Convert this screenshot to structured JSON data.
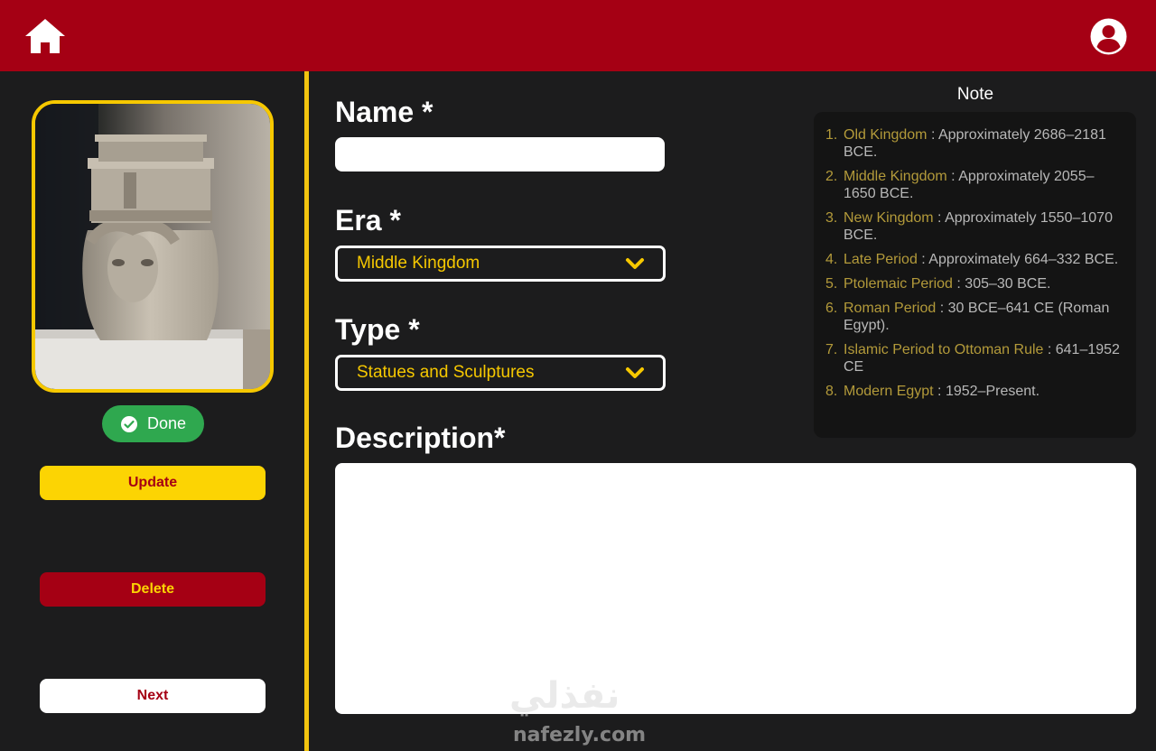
{
  "header": {
    "home_icon": "home-icon",
    "user_icon": "user-account-icon",
    "background_color": "#a50014"
  },
  "sidebar": {
    "status_badge": {
      "label": "Done",
      "icon": "check-circle-icon",
      "color": "#2fa84f"
    },
    "buttons": {
      "update_label": "Update",
      "delete_label": "Delete",
      "next_label": "Next"
    }
  },
  "form": {
    "name_label": "Name *",
    "name_value": "",
    "era_label": "Era *",
    "era_selected": "Middle Kingdom",
    "type_label": "Type *",
    "type_selected": "Statues and Sculptures",
    "description_label": "Description*",
    "description_value": ""
  },
  "note": {
    "title": "Note",
    "items": [
      {
        "num": "1.",
        "era": "Old Kingdom",
        "text": " : Approximately 2686–2181 BCE."
      },
      {
        "num": "2.",
        "era": "Middle Kingdom",
        "text": " : Approximately 2055–1650 BCE."
      },
      {
        "num": "3.",
        "era": "New Kingdom",
        "text": " : Approximately 1550–1070 BCE."
      },
      {
        "num": "4.",
        "era": "Late Period",
        "text": " : Approximately 664–332 BCE."
      },
      {
        "num": "5.",
        "era": "Ptolemaic Period",
        "text": " : 305–30 BCE."
      },
      {
        "num": "6.",
        "era": "Roman Period",
        "text": " : 30 BCE–641 CE (Roman Egypt)."
      },
      {
        "num": "7.",
        "era": "Islamic Period to  Ottoman Rule",
        "text": " : 641–1952 CE"
      },
      {
        "num": "8.",
        "era": "Modern Egypt",
        "text": " : 1952–Present."
      }
    ]
  },
  "colors": {
    "accent_yellow": "#f6c800",
    "accent_red": "#a50014",
    "success_green": "#2fa84f",
    "background": "#1c1c1d"
  },
  "watermark": {
    "arabic": "نفذلي",
    "latin": "nafezly.com"
  }
}
